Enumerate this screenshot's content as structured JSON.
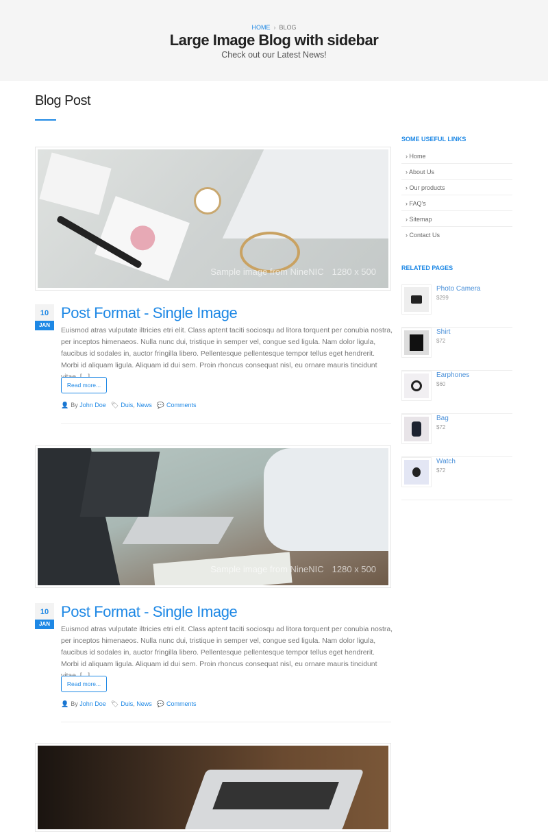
{
  "hero": {
    "breadcrumb": [
      {
        "label": "HOME"
      },
      {
        "label": "BLOG"
      }
    ],
    "title": "Large Image Blog with sidebar",
    "subtitle": "Check out our Latest News!"
  },
  "page_title": "Blog Post",
  "posts": [
    {
      "watermark": "Sample image from NineNIC",
      "size": "1280 x 500",
      "day": "10",
      "month": "JAN",
      "title": "Post Format - Single Image",
      "excerpt": "Euismod atras vulputate iltricies etri elit. Class aptent taciti sociosqu ad litora torquent per conubia nostra, per inceptos himenaeos. Nulla nunc dui, tristique in semper vel, congue sed ligula. Nam dolor ligula, faucibus id sodales in, auctor fringilla libero. Pellentesque pellentesque tempor tellus eget hendrerit. Morbi id aliquam ligula. Aliquam id dui sem. Proin rhoncus consequat nisl, eu ornare mauris tincidunt vitae. [...]",
      "read_more": "Read more...",
      "by": "By",
      "author": "John Doe",
      "tag1": "Duis",
      "tag2": "News",
      "comments": "Comments"
    },
    {
      "watermark": "Sample image from NineNIC",
      "size": "1280 x 500",
      "day": "10",
      "month": "JAN",
      "title": "Post Format - Single Image",
      "excerpt": "Euismod atras vulputate iltricies etri elit. Class aptent taciti sociosqu ad litora torquent per conubia nostra, per inceptos himenaeos. Nulla nunc dui, tristique in semper vel, congue sed ligula. Nam dolor ligula, faucibus id sodales in, auctor fringilla libero. Pellentesque pellentesque tempor tellus eget hendrerit. Morbi id aliquam ligula. Aliquam id dui sem. Proin rhoncus consequat nisl, eu ornare mauris tincidunt vitae. [...]",
      "read_more": "Read more...",
      "by": "By",
      "author": "John Doe",
      "tag1": "Duis",
      "tag2": "News",
      "comments": "Comments"
    }
  ],
  "sidebar": {
    "links_title": "SOME USEFUL LINKS",
    "links": [
      "Home",
      "About Us",
      "Our products",
      "FAQ's",
      "Sitemap",
      "Contact Us"
    ],
    "related_title": "RELATED PAGES",
    "related": [
      {
        "name": "Photo Camera",
        "price": "$299"
      },
      {
        "name": "Shirt",
        "price": "$72"
      },
      {
        "name": "Earphones",
        "price": "$60"
      },
      {
        "name": "Bag",
        "price": "$72"
      },
      {
        "name": "Watch",
        "price": "$72"
      }
    ]
  },
  "colors": {
    "accent": "#1e88e5",
    "hero_bg": "#f5f5f5"
  }
}
